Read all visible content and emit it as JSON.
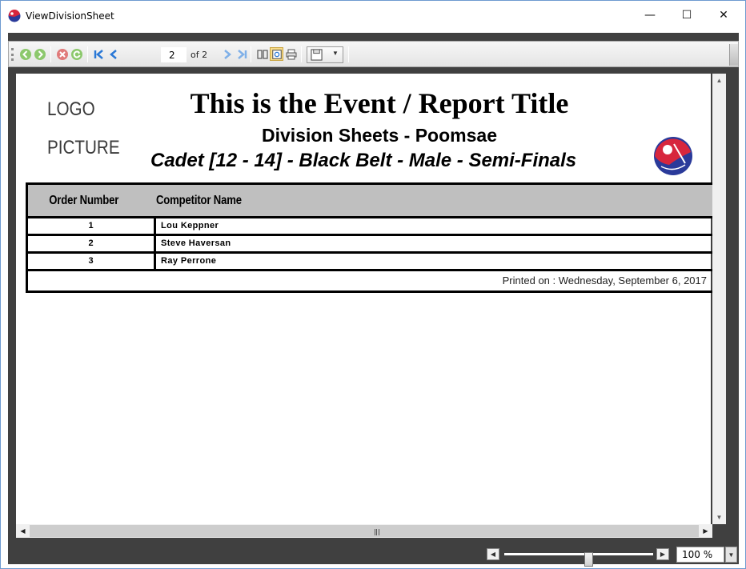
{
  "window": {
    "title": "ViewDivisionSheet",
    "min_glyph": "—",
    "max_glyph": "☐",
    "close_glyph": "✕"
  },
  "toolbar": {
    "page_current": "2",
    "page_of": "of 2"
  },
  "report": {
    "logo_line1": "LOGO",
    "logo_line2": "PICTURE",
    "title": "This is the Event / Report Title",
    "subtitle": "Division Sheets - Poomsae",
    "division": "Cadet [12 - 14] - Black Belt - Male - Semi-Finals",
    "columns": {
      "order": "Order Number",
      "name": "Competitor Name"
    },
    "rows": [
      {
        "order": "1",
        "name": "Lou  Keppner"
      },
      {
        "order": "2",
        "name": "Steve  Haversan"
      },
      {
        "order": "3",
        "name": "Ray  Perrone"
      }
    ],
    "printed": "Printed on :  Wednesday, September 6, 2017"
  },
  "zoom": {
    "value": "100 %",
    "slider_fraction": 0.57
  },
  "colors": {
    "header_bg": "#bfbfbf",
    "chrome_bg": "#404040",
    "accent_red": "#d7263d",
    "accent_blue": "#2a3a9a"
  }
}
